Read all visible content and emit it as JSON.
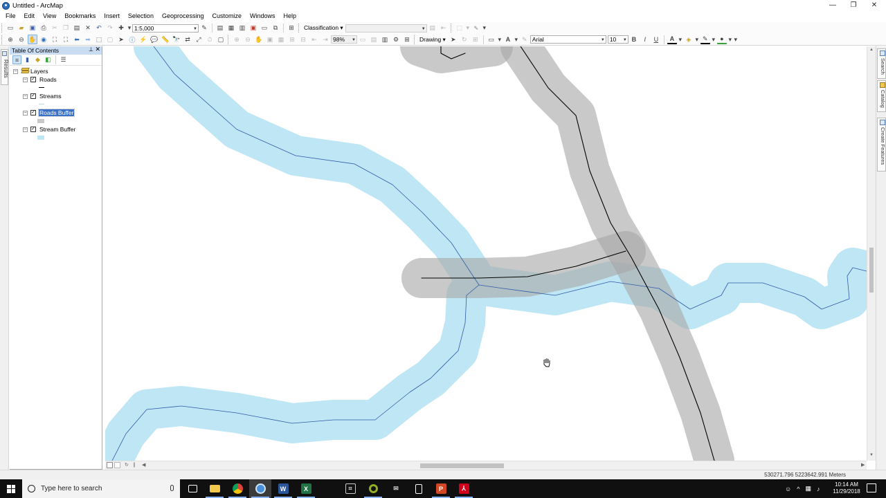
{
  "window": {
    "title": "Untitled - ArcMap",
    "controls": {
      "minimize": "—",
      "maximize": "❐",
      "close": "✕"
    }
  },
  "menubar": {
    "items": [
      "File",
      "Edit",
      "View",
      "Bookmarks",
      "Insert",
      "Selection",
      "Geoprocessing",
      "Customize",
      "Windows",
      "Help"
    ]
  },
  "toolbar": {
    "scale": "1:5,000",
    "classification_label": "Classification ▾",
    "classification_value": "",
    "zoom_percent": "98%",
    "drawing_label": "Drawing ▾",
    "font_name": "Arial",
    "font_size": "10",
    "bold": "B",
    "italic": "I",
    "underline": "U"
  },
  "left_strip": {
    "results_tab": "Results"
  },
  "toc": {
    "title": "Table Of Contents",
    "root": "Layers",
    "layers": [
      {
        "name": "Roads",
        "checked": true,
        "symbol_type": "line",
        "symbol_color": "#000000",
        "selected": false
      },
      {
        "name": "Streams",
        "checked": true,
        "symbol_type": "line",
        "symbol_color": "#b7d6e6",
        "selected": false
      },
      {
        "name": "Roads Buffer",
        "checked": true,
        "symbol_type": "fill",
        "symbol_color": "#c8c8c8",
        "selected": true
      },
      {
        "name": "Stream Buffer",
        "checked": true,
        "symbol_type": "fill",
        "symbol_color": "#bee6f4",
        "selected": false
      }
    ]
  },
  "map": {
    "colors": {
      "stream_buffer": "#bee6f4",
      "stream_line": "#2f5aa8",
      "road_buffer": "#a8a8a8",
      "road_line": "#000000"
    },
    "cursor": "hand-pan-icon"
  },
  "right_strip": {
    "tabs": [
      "Search",
      "Catalog",
      "Create Features"
    ]
  },
  "statusbar": {
    "coordinates": "530271.796  5223642.991 Meters"
  },
  "taskbar": {
    "search_placeholder": "Type here to search",
    "clock_time": "10:14 AM",
    "clock_date": "11/29/2018",
    "apps": [
      "task-view",
      "file-explorer",
      "chrome",
      "arcmap",
      "word",
      "excel",
      "arcgis-tool",
      "qgis",
      "mail",
      "calculator",
      "powerpoint",
      "acrobat"
    ]
  }
}
